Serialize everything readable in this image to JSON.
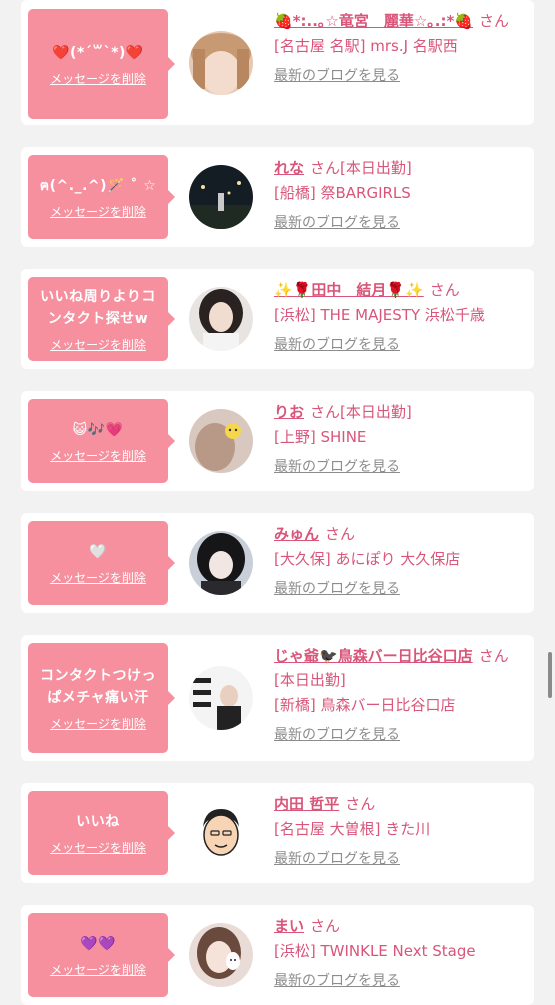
{
  "labels": {
    "delete": "メッセージを削除",
    "blog": "最新のブログを見る",
    "san": "さん"
  },
  "cards": [
    {
      "message": "❤️(*´꒳`*)❤️",
      "name": "🍓*:..｡☆竜宮　麗華☆｡.:*🍓",
      "tag": "",
      "shop": "[名古屋 名駅] mrs.J 名駅西"
    },
    {
      "message": "ฅ(^._.^)🪄 ˚ ☆",
      "name": "れな",
      "tag": "[本日出勤]",
      "shop": "[船橋] 祭BARGIRLS"
    },
    {
      "message": "いいね周りよりコンタクト探せw",
      "name": "✨🌹田中　結月🌹✨",
      "tag": "",
      "shop": "[浜松] THE MAJESTY 浜松千歳"
    },
    {
      "message": "😺🎶💗",
      "name": "りお",
      "tag": "[本日出勤]",
      "shop": "[上野] SHINE"
    },
    {
      "message": "🤍",
      "name": "みゅん",
      "tag": "",
      "shop": "[大久保] あにぽり 大久保店"
    },
    {
      "message": "コンタクトつけっぱメチャ痛い汗",
      "name": "じゃ爺🐦‍⬛鳥森バー日比谷口店",
      "tag": "[本日出勤]",
      "shop": "[新橋] 鳥森バー日比谷口店"
    },
    {
      "message": "いいね",
      "name": "内田 哲平",
      "tag": "",
      "shop": "[名古屋 大曽根] きた川"
    },
    {
      "message": "💜💜",
      "name": "まい",
      "tag": "",
      "shop": "[浜松] TWINKLE Next Stage"
    }
  ],
  "colors": {
    "accent": "#d9557a",
    "bubble": "#f6909f",
    "muted": "#8c8c8c",
    "background": "#f2f2f2"
  },
  "icons": {
    "avatar": "user-avatar-photo"
  }
}
